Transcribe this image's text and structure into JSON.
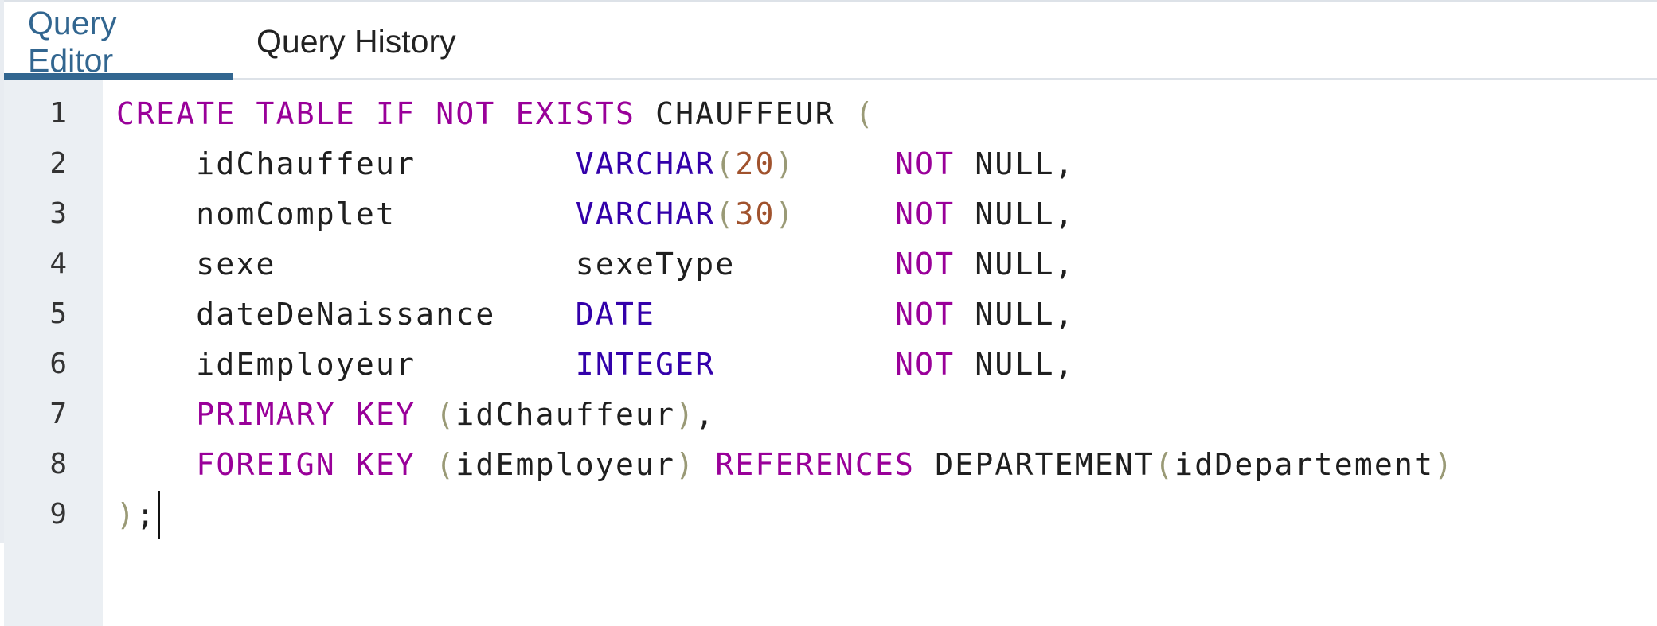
{
  "tabs": [
    {
      "label": "Query Editor",
      "active": true
    },
    {
      "label": "Query History",
      "active": false
    }
  ],
  "colors": {
    "accent": "#326690",
    "keyword": "#990099",
    "type": "#3300aa",
    "number": "#a0522d",
    "paren": "#9a9a76",
    "gutter": "#ebeff3"
  },
  "line_numbers": [
    "1",
    "2",
    "3",
    "4",
    "5",
    "6",
    "7",
    "8",
    "9"
  ],
  "code_lines": [
    [
      {
        "t": "CREATE",
        "c": "kw"
      },
      {
        "t": " ",
        "c": "plain"
      },
      {
        "t": "TABLE",
        "c": "kw"
      },
      {
        "t": " ",
        "c": "plain"
      },
      {
        "t": "IF",
        "c": "kw"
      },
      {
        "t": " ",
        "c": "plain"
      },
      {
        "t": "NOT",
        "c": "kw"
      },
      {
        "t": " ",
        "c": "plain"
      },
      {
        "t": "EXISTS",
        "c": "kw"
      },
      {
        "t": " CHAUFFEUR ",
        "c": "plain"
      },
      {
        "t": "(",
        "c": "par"
      }
    ],
    [
      {
        "t": "    idChauffeur        ",
        "c": "plain"
      },
      {
        "t": "VARCHAR",
        "c": "type"
      },
      {
        "t": "(",
        "c": "par"
      },
      {
        "t": "20",
        "c": "num"
      },
      {
        "t": ")",
        "c": "par"
      },
      {
        "t": "     ",
        "c": "plain"
      },
      {
        "t": "NOT",
        "c": "kw"
      },
      {
        "t": " NULL,",
        "c": "plain"
      }
    ],
    [
      {
        "t": "    nomComplet         ",
        "c": "plain"
      },
      {
        "t": "VARCHAR",
        "c": "type"
      },
      {
        "t": "(",
        "c": "par"
      },
      {
        "t": "30",
        "c": "num"
      },
      {
        "t": ")",
        "c": "par"
      },
      {
        "t": "     ",
        "c": "plain"
      },
      {
        "t": "NOT",
        "c": "kw"
      },
      {
        "t": " NULL,",
        "c": "plain"
      }
    ],
    [
      {
        "t": "    sexe               sexeType        ",
        "c": "plain"
      },
      {
        "t": "NOT",
        "c": "kw"
      },
      {
        "t": " NULL,",
        "c": "plain"
      }
    ],
    [
      {
        "t": "    dateDeNaissance    ",
        "c": "plain"
      },
      {
        "t": "DATE",
        "c": "type"
      },
      {
        "t": "            ",
        "c": "plain"
      },
      {
        "t": "NOT",
        "c": "kw"
      },
      {
        "t": " NULL,",
        "c": "plain"
      }
    ],
    [
      {
        "t": "    idEmployeur        ",
        "c": "plain"
      },
      {
        "t": "INTEGER",
        "c": "type"
      },
      {
        "t": "         ",
        "c": "plain"
      },
      {
        "t": "NOT",
        "c": "kw"
      },
      {
        "t": " NULL,",
        "c": "plain"
      }
    ],
    [
      {
        "t": "    ",
        "c": "plain"
      },
      {
        "t": "PRIMARY",
        "c": "kw"
      },
      {
        "t": " ",
        "c": "plain"
      },
      {
        "t": "KEY",
        "c": "kw"
      },
      {
        "t": " ",
        "c": "plain"
      },
      {
        "t": "(",
        "c": "par"
      },
      {
        "t": "idChauffeur",
        "c": "plain"
      },
      {
        "t": ")",
        "c": "par"
      },
      {
        "t": ",",
        "c": "plain"
      }
    ],
    [
      {
        "t": "    ",
        "c": "plain"
      },
      {
        "t": "FOREIGN",
        "c": "kw"
      },
      {
        "t": " ",
        "c": "plain"
      },
      {
        "t": "KEY",
        "c": "kw"
      },
      {
        "t": " ",
        "c": "plain"
      },
      {
        "t": "(",
        "c": "par"
      },
      {
        "t": "idEmployeur",
        "c": "plain"
      },
      {
        "t": ")",
        "c": "par"
      },
      {
        "t": " ",
        "c": "plain"
      },
      {
        "t": "REFERENCES",
        "c": "kw"
      },
      {
        "t": " DEPARTEMENT",
        "c": "plain"
      },
      {
        "t": "(",
        "c": "par"
      },
      {
        "t": "idDepartement",
        "c": "plain"
      },
      {
        "t": ")",
        "c": "par"
      }
    ],
    [
      {
        "t": ")",
        "c": "par"
      },
      {
        "t": ";",
        "c": "plain"
      }
    ]
  ]
}
